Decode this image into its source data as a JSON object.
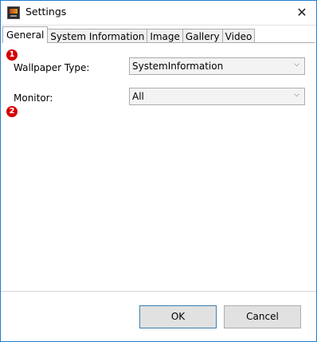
{
  "window": {
    "title": "Settings",
    "close_glyph": "✕"
  },
  "tabs": [
    {
      "label": "General",
      "active": true
    },
    {
      "label": "System Information",
      "active": false
    },
    {
      "label": "Image",
      "active": false
    },
    {
      "label": "Gallery",
      "active": false
    },
    {
      "label": "Video",
      "active": false
    }
  ],
  "general": {
    "wallpaper_type": {
      "badge": "1",
      "label": "Wallpaper Type:",
      "value": "SystemInformation"
    },
    "monitor": {
      "badge": "2",
      "label": "Monitor:",
      "value": "All"
    }
  },
  "buttons": {
    "ok": "OK",
    "cancel": "Cancel"
  },
  "colors": {
    "window_border": "#1f7fd0",
    "badge": "#d40000",
    "default_button_border": "#3c7fb1"
  }
}
